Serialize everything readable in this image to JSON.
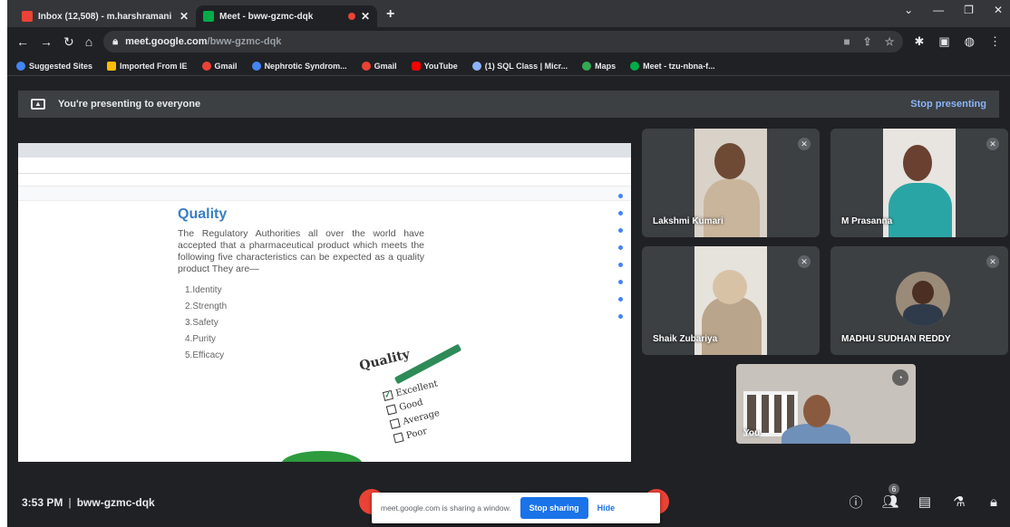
{
  "browser": {
    "tabs": [
      {
        "label": "Inbox (12,508) - m.harshramani",
        "active": false,
        "favicon_color": "#ea4335"
      },
      {
        "label": "Meet - bww-gzmc-dqk",
        "active": true,
        "favicon_color": "#00ac47"
      }
    ],
    "url_host": "meet.google.com",
    "url_path": "/bww-gzmc-dqk",
    "bookmarks": [
      {
        "label": "Suggested Sites",
        "color": "#4285f4"
      },
      {
        "label": "Imported From IE",
        "color": "#fbbc04"
      },
      {
        "label": "Gmail",
        "color": "#ea4335"
      },
      {
        "label": "Nephrotic Syndrom...",
        "color": "#4285f4"
      },
      {
        "label": "Gmail",
        "color": "#ea4335"
      },
      {
        "label": "YouTube",
        "color": "#ff0000"
      },
      {
        "label": "(1) SQL Class | Micr...",
        "color": "#8ab4f8"
      },
      {
        "label": "Maps",
        "color": "#34a853"
      },
      {
        "label": "Meet - tzu-nbna-f...",
        "color": "#00ac47"
      }
    ]
  },
  "presenting_bar": {
    "message": "You're presenting to everyone",
    "stop_label": "Stop presenting"
  },
  "shared_screen": {
    "slide": {
      "title": "Quality",
      "body": "The Regulatory Authorities all over the world have accepted that a pharmaceutical product which meets the following five characteristics can be expected as a quality product They are—",
      "items": [
        "1.Identity",
        "2.Strength",
        "3.Safety",
        "4.Purity",
        "5.Efficacy"
      ]
    },
    "graphic": {
      "title": "Quality",
      "choices": [
        "Excellent",
        "Good",
        "Average",
        "Poor"
      ],
      "checked_index": 0
    }
  },
  "participants": [
    {
      "name": "Lakshmi Kumari"
    },
    {
      "name": "M Prasanna"
    },
    {
      "name": "Shaik Zubariya"
    },
    {
      "name": "MADHU SUDHAN REDDY"
    }
  ],
  "self_view": {
    "name": "You"
  },
  "bottom_bar": {
    "time": "3:53 PM",
    "meeting_code": "bww-gzmc-dqk",
    "share_message": "meet.google.com is sharing a window.",
    "stop_sharing_label": "Stop sharing",
    "hide_label": "Hide",
    "participant_count": "6"
  },
  "colors": {
    "meet_dark": "#202124",
    "tile_bg": "#3c4043",
    "accent_blue": "#1a73e8",
    "end_call_red": "#ea4335"
  }
}
